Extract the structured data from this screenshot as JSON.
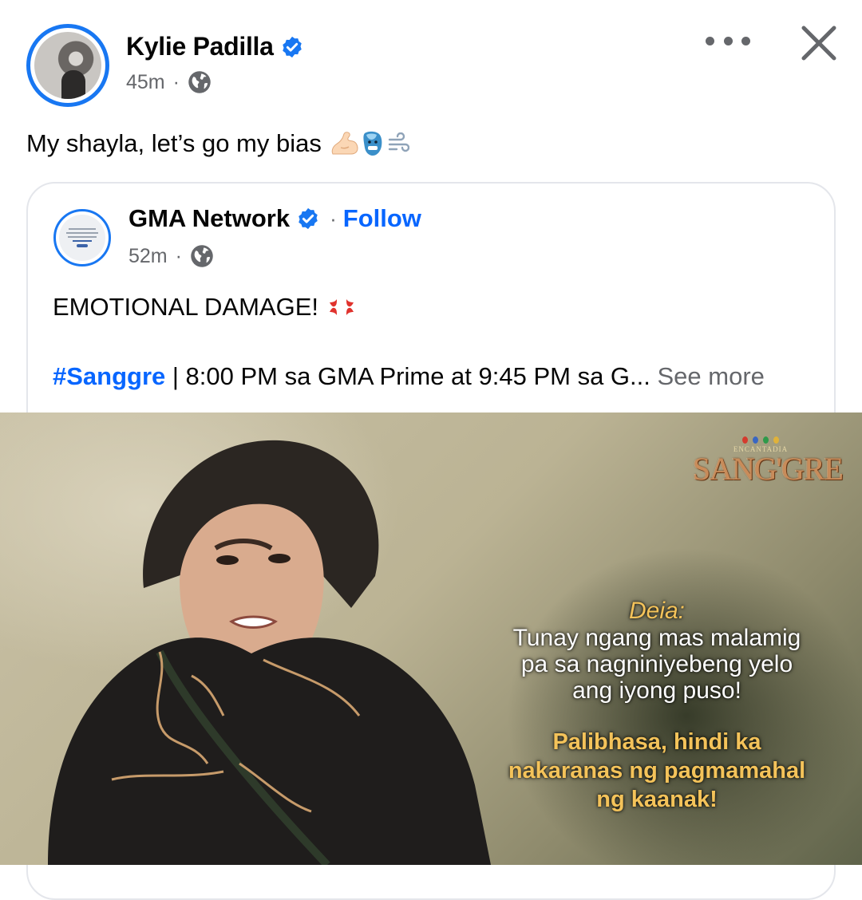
{
  "post": {
    "author": "Kylie Padilla",
    "time": "45m",
    "separator": "·",
    "text": "My shayla, let’s go my bias"
  },
  "shared": {
    "page_name": "GMA Network",
    "dot": "·",
    "follow_label": "Follow",
    "time": "52m",
    "separator": "·",
    "headline": "EMOTIONAL DAMAGE!",
    "hashtag": "#Sanggre",
    "caption": " | 8:00 PM sa GMA Prime at 9:45 PM sa G... ",
    "see_more": "See more"
  },
  "media": {
    "logo_small": "ENCANTADIA",
    "logo_main": "SANG'GRE",
    "subtitle": {
      "speaker": "Deia:",
      "line1": "Tunay ngang mas malamig",
      "line2": "pa sa nagniniyebeng yelo",
      "line3": "ang iyong puso!",
      "line4": "Palibhasa, hindi ka",
      "line5": "nakaranas ng pagmamahal",
      "line6": "ng kaanak!"
    }
  },
  "icons": {
    "verified": "verified-badge-icon",
    "globe": "globe-icon",
    "more": "more-options-icon",
    "close": "close-icon",
    "emoji": [
      "flexed-biceps-emoji",
      "cold-face-emoji",
      "wind-emoji"
    ],
    "headline_emoji": "anger-symbol-emoji"
  },
  "colors": {
    "brand_blue": "#1877f2",
    "link_blue": "#0866ff",
    "secondary_text": "#65676b",
    "subtitle_gold": "#f4c35a"
  }
}
